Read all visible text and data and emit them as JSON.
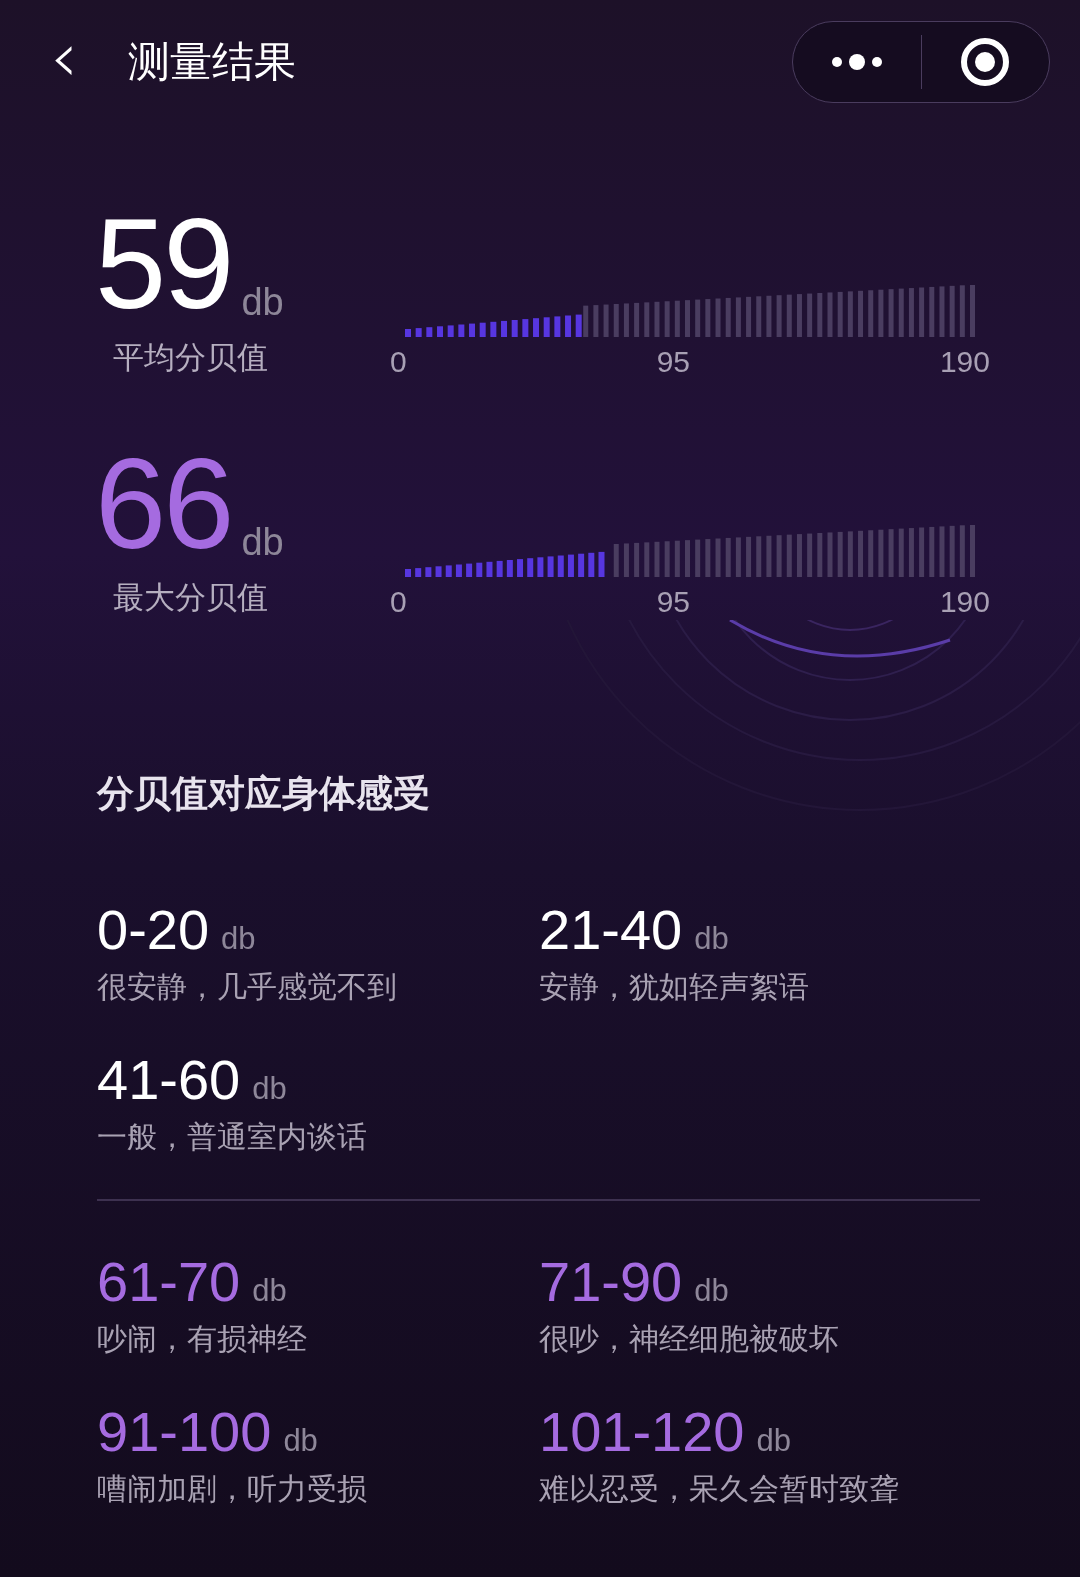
{
  "header": {
    "title": "测量结果",
    "back": "‹"
  },
  "measurements": [
    {
      "value": "59",
      "unit": "db",
      "label": "平均分贝值",
      "color": "#ffffff",
      "level": 0.31,
      "ticks": [
        "0",
        "95",
        "190"
      ]
    },
    {
      "value": "66",
      "unit": "db",
      "label": "最大分贝值",
      "color": "#a56be0",
      "level": 0.35,
      "ticks": [
        "0",
        "95",
        "190"
      ]
    }
  ],
  "section_title": "分贝值对应身体感受",
  "range_groups": [
    [
      {
        "range": "0-20",
        "unit": "db",
        "desc": "很安静，几乎感觉不到",
        "color": "#ffffff"
      },
      {
        "range": "21-40",
        "unit": "db",
        "desc": "安静，犹如轻声絮语",
        "color": "#ffffff"
      },
      {
        "range": "41-60",
        "unit": "db",
        "desc": "一般，普通室内谈话",
        "color": "#ffffff"
      }
    ],
    [
      {
        "range": "61-70",
        "unit": "db",
        "desc": "吵闹，有损神经",
        "color": "#a56be0"
      },
      {
        "range": "71-90",
        "unit": "db",
        "desc": "很吵，神经细胞被破坏",
        "color": "#a56be0"
      },
      {
        "range": "91-100",
        "unit": "db",
        "desc": "嘈闹加剧，听力受损",
        "color": "#a56be0"
      },
      {
        "range": "101-120",
        "unit": "db",
        "desc": "难以忍受，呆久会暂时致聋",
        "color": "#a56be0"
      }
    ]
  ]
}
